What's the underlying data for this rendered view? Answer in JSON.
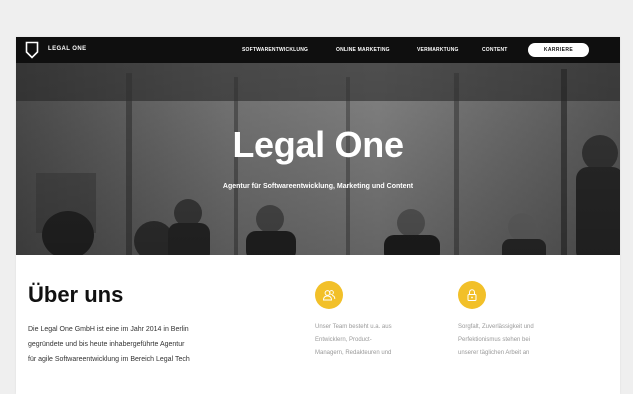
{
  "brand": {
    "name": "LEGAL ONE"
  },
  "nav": {
    "items": [
      {
        "label": "SOFTWARENTWICKLUNG"
      },
      {
        "label": "ONLINE MARKETING"
      },
      {
        "label": "VERMARKTUNG"
      },
      {
        "label": "CONTENT"
      }
    ],
    "career_label": "KARRIERE"
  },
  "hero": {
    "title": "Legal One",
    "subtitle": "Agentur für Softwareentwicklung, Marketing und Content"
  },
  "about": {
    "title": "Über uns",
    "text_lines": [
      "Die Legal One GmbH ist eine im Jahr 2014 in Berlin",
      "gegründete und bis heute inhabergeführte Agentur",
      "für agile Softwareentwicklung im Bereich Legal Tech"
    ]
  },
  "features": [
    {
      "icon": "team-icon",
      "lines": [
        "Unser Team besteht u.a. aus",
        "Entwicklern, Product-",
        "Managern, Redakteuren und"
      ]
    },
    {
      "icon": "lock-icon",
      "lines": [
        "Sorgfalt, Zuverlässigkeit und",
        "Perfektionismus stehen bei",
        "unserer täglichen Arbeit an"
      ]
    }
  ],
  "colors": {
    "accent": "#f2c029",
    "topbar": "#0f0f0f",
    "page_bg": "#efefef"
  }
}
